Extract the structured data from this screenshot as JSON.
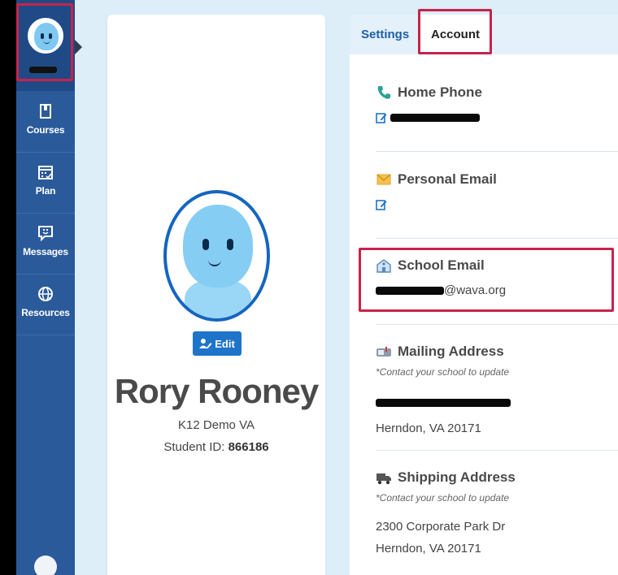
{
  "sidebar": {
    "items": [
      {
        "label": "Courses",
        "icon": "book-icon"
      },
      {
        "label": "Plan",
        "icon": "calendar-icon"
      },
      {
        "label": "Messages",
        "icon": "chat-icon"
      },
      {
        "label": "Resources",
        "icon": "globe-icon"
      }
    ]
  },
  "profile": {
    "edit_label": "Edit",
    "name": "Rory Rooney",
    "school": "K12 Demo VA",
    "student_id_label": "Student ID:",
    "student_id": "866186"
  },
  "tabs": [
    {
      "label": "Settings",
      "active": false
    },
    {
      "label": "Account",
      "active": true
    }
  ],
  "account": {
    "home_phone": {
      "title": "Home Phone"
    },
    "personal_email": {
      "title": "Personal Email"
    },
    "school_email": {
      "title": "School Email",
      "value_suffix": "@wava.org"
    },
    "mailing_address": {
      "title": "Mailing Address",
      "note": "*Contact your school to update",
      "line2": "Herndon, VA 20171"
    },
    "shipping_address": {
      "title": "Shipping Address",
      "note": "*Contact your school to update",
      "line1": "2300 Corporate Park Dr",
      "line2": "Herndon, VA 20171"
    }
  },
  "colors": {
    "sidebar": "#2b5a9b",
    "accent": "#1e74c8",
    "highlight": "#c6234b",
    "background": "#ddeef9"
  }
}
